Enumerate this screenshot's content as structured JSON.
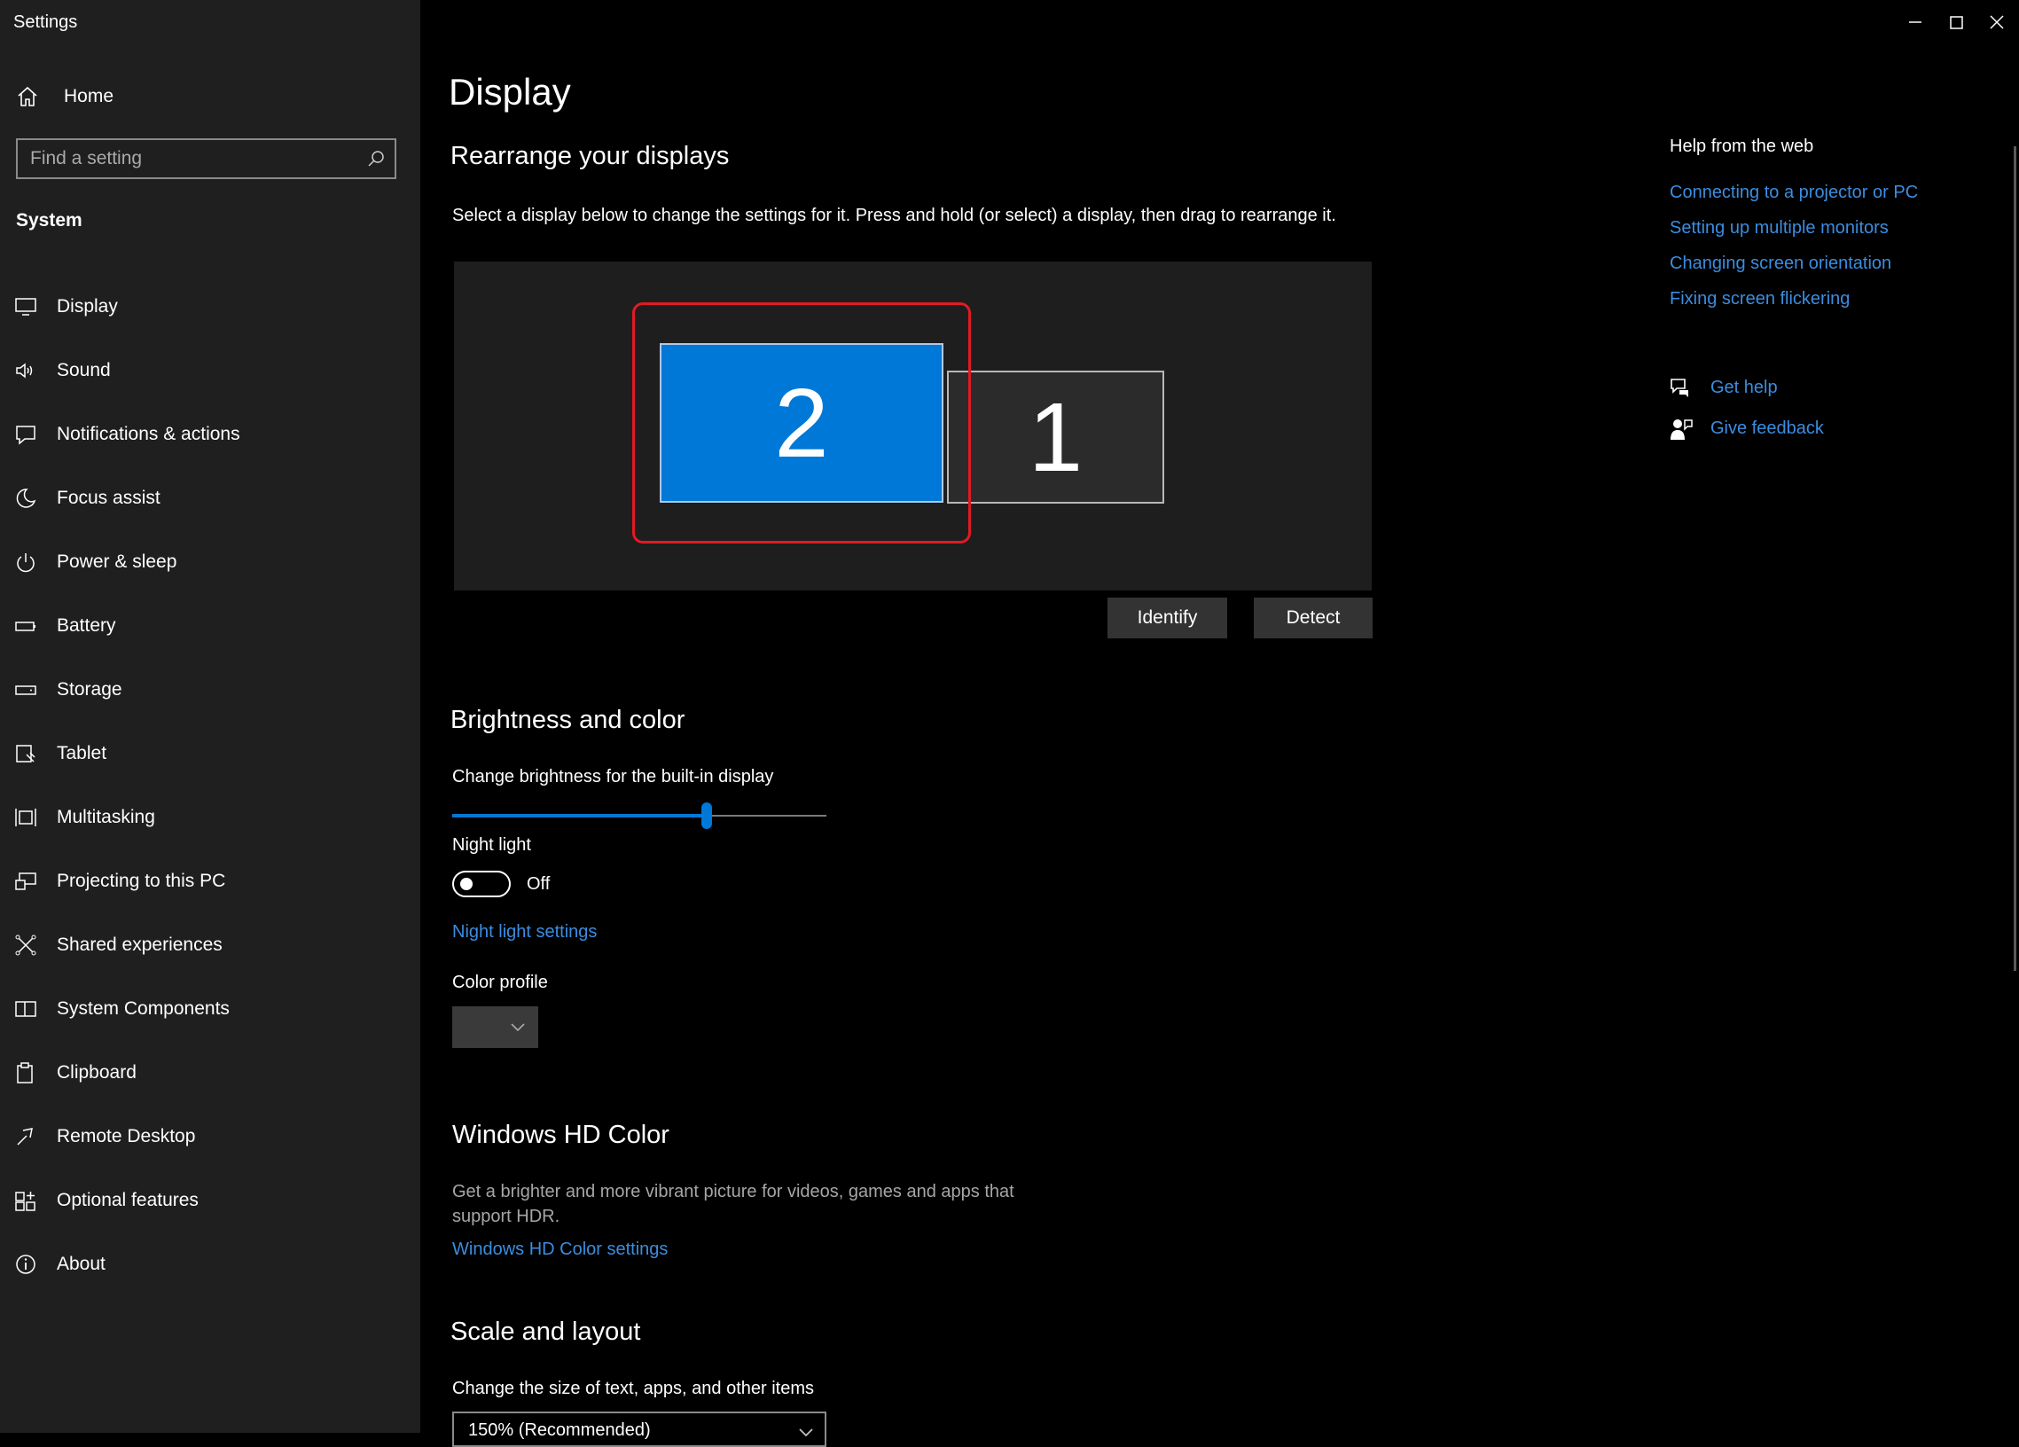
{
  "window": {
    "title": "Settings"
  },
  "sidebar": {
    "home_label": "Home",
    "search_placeholder": "Find a setting",
    "section_label": "System",
    "items": [
      {
        "label": "Display",
        "icon": "monitor-icon"
      },
      {
        "label": "Sound",
        "icon": "speaker-icon"
      },
      {
        "label": "Notifications & actions",
        "icon": "notification-icon"
      },
      {
        "label": "Focus assist",
        "icon": "moon-icon"
      },
      {
        "label": "Power & sleep",
        "icon": "power-icon"
      },
      {
        "label": "Battery",
        "icon": "battery-icon"
      },
      {
        "label": "Storage",
        "icon": "storage-icon"
      },
      {
        "label": "Tablet",
        "icon": "tablet-icon"
      },
      {
        "label": "Multitasking",
        "icon": "multitasking-icon"
      },
      {
        "label": "Projecting to this PC",
        "icon": "projector-icon"
      },
      {
        "label": "Shared experiences",
        "icon": "shared-icon"
      },
      {
        "label": "System Components",
        "icon": "components-icon"
      },
      {
        "label": "Clipboard",
        "icon": "clipboard-icon"
      },
      {
        "label": "Remote Desktop",
        "icon": "remote-desktop-icon"
      },
      {
        "label": "Optional features",
        "icon": "optional-features-icon"
      },
      {
        "label": "About",
        "icon": "info-icon"
      }
    ]
  },
  "main": {
    "title": "Display",
    "rearrange": {
      "heading": "Rearrange your displays",
      "description": "Select a display below to change the settings for it. Press and hold (or select) a display, then drag to rearrange it.",
      "monitors": [
        {
          "number": "2",
          "selected": true
        },
        {
          "number": "1",
          "selected": false
        }
      ],
      "identify_label": "Identify",
      "detect_label": "Detect"
    },
    "brightness": {
      "heading": "Brightness and color",
      "label": "Change brightness for the built-in display",
      "value_percent": 68,
      "night_light_label": "Night light",
      "night_light_state": "Off",
      "night_light_link": "Night light settings",
      "color_profile_label": "Color profile"
    },
    "hdr": {
      "heading": "Windows HD Color",
      "description_line1": "Get a brighter and more vibrant picture for videos, games and apps that",
      "description_line2": "support HDR.",
      "link": "Windows HD Color settings"
    },
    "scale": {
      "heading": "Scale and layout",
      "label": "Change the size of text, apps, and other items",
      "value": "150% (Recommended)"
    }
  },
  "help": {
    "heading": "Help from the web",
    "links": [
      "Connecting to a projector or PC",
      "Setting up multiple monitors",
      "Changing screen orientation",
      "Fixing screen flickering"
    ],
    "get_help": "Get help",
    "give_feedback": "Give feedback"
  },
  "colors": {
    "accent": "#0078d7",
    "link": "#3b8de0",
    "highlight": "#e21a24"
  }
}
